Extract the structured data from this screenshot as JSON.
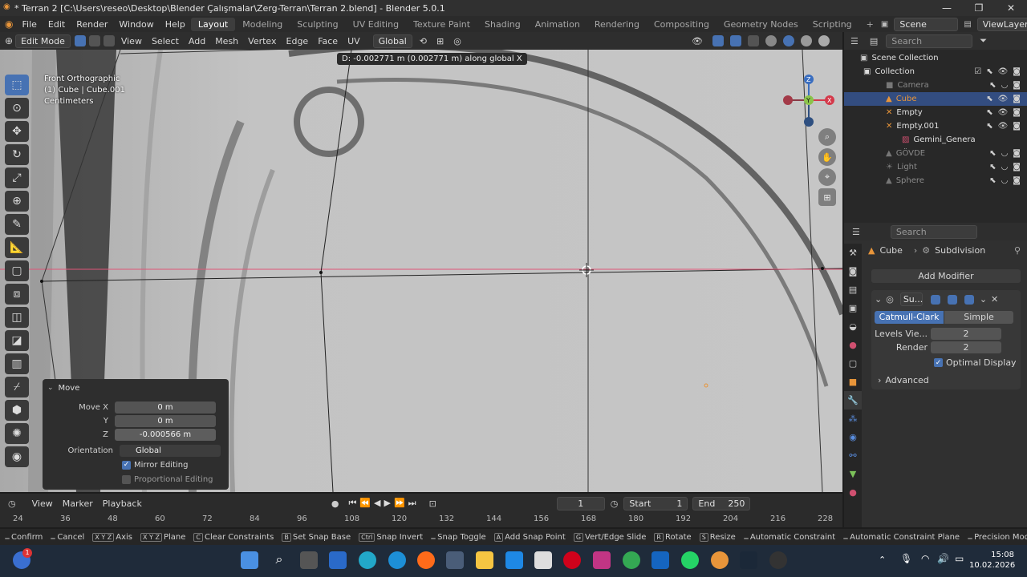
{
  "window": {
    "title": "* Terran 2 [C:\\Users\\reseo\\Desktop\\Blender Çalışmalar\\Zerg-Terran\\Terran 2.blend] - Blender 5.0.1",
    "minimize": "—",
    "maximize": "❐",
    "close": "✕"
  },
  "menu": {
    "items": [
      "File",
      "Edit",
      "Render",
      "Window",
      "Help"
    ],
    "workspaces": [
      "Layout",
      "Modeling",
      "Sculpting",
      "UV Editing",
      "Texture Paint",
      "Shading",
      "Animation",
      "Rendering",
      "Compositing",
      "Geometry Nodes",
      "Scripting"
    ],
    "add_workspace": "+",
    "scene": "Scene",
    "view_layer": "ViewLayer"
  },
  "viewport_header": {
    "mode": "Edit Mode",
    "menus": [
      "View",
      "Select",
      "Add",
      "Mesh",
      "Vertex",
      "Edge",
      "Face",
      "UV"
    ],
    "orientation": "Global"
  },
  "viewport": {
    "info_view": "Front Orthographic",
    "info_object": "(1) Cube | Cube.001",
    "info_units": "Centimeters",
    "transform_text": "D: -0.002771 m (0.002771 m) along global X",
    "gizmo": {
      "z": "Z",
      "y": "Y",
      "x": "X"
    }
  },
  "move_panel": {
    "title": "Move",
    "move_x_label": "Move X",
    "move_x": "0 m",
    "y_label": "Y",
    "y": "0 m",
    "z_label": "Z",
    "z": "-0.000566 m",
    "orientation_label": "Orientation",
    "orientation": "Global",
    "mirror_editing": "Mirror Editing",
    "proportional_editing": "Proportional Editing"
  },
  "outliner": {
    "search_placeholder": "Search",
    "scene_collection": "Scene Collection",
    "collection": "Collection",
    "items": [
      "Camera",
      "Cube",
      "Empty",
      "Empty.001",
      "Gemini_Genera",
      "GÖVDE",
      "Light",
      "Sphere"
    ]
  },
  "properties": {
    "search_placeholder": "Search",
    "object": "Cube",
    "modifier_label": "Subdivision",
    "add_modifier": "Add Modifier",
    "modifier_short": "Su...",
    "catmull": "Catmull-Clark",
    "simple": "Simple",
    "levels_label": "Levels Vie...",
    "levels_value": "2",
    "render_label": "Render",
    "render_value": "2",
    "optimal_display": "Optimal Display",
    "advanced": "Advanced"
  },
  "timeline": {
    "menus": [
      "View",
      "Marker",
      "Playback"
    ],
    "current_frame": "1",
    "start_label": "Start",
    "start": "1",
    "end_label": "End",
    "end": "250",
    "ticks": [
      "24",
      "36",
      "48",
      "60",
      "72",
      "84",
      "96",
      "108",
      "120",
      "132",
      "144",
      "156",
      "168",
      "180",
      "192",
      "204",
      "216",
      "228"
    ]
  },
  "statusbar": {
    "items": [
      {
        "key": "",
        "label": "Confirm"
      },
      {
        "key": "",
        "label": "Cancel"
      },
      {
        "key": "X Y Z",
        "label": "Axis"
      },
      {
        "key": "X Y Z",
        "label": "Plane"
      },
      {
        "key": "C",
        "label": "Clear Constraints"
      },
      {
        "key": "B",
        "label": "Set Snap Base"
      },
      {
        "key": "Ctrl",
        "label": "Snap Invert"
      },
      {
        "key": "",
        "label": "Snap Toggle"
      },
      {
        "key": "A",
        "label": "Add Snap Point"
      },
      {
        "key": "G",
        "label": "Vert/Edge Slide"
      },
      {
        "key": "R",
        "label": "Rotate"
      },
      {
        "key": "S",
        "label": "Resize"
      },
      {
        "key": "",
        "label": "Automatic Constraint"
      },
      {
        "key": "",
        "label": "Automatic Constraint Plane"
      },
      {
        "key": "",
        "label": "Precision Mode"
      }
    ]
  },
  "taskbar": {
    "time": "15:08",
    "date": "10.02.2026",
    "badge": "1"
  },
  "colors": {
    "accent": "#4772b3",
    "selected_row": "#334d80",
    "orange": "#e8953a"
  }
}
